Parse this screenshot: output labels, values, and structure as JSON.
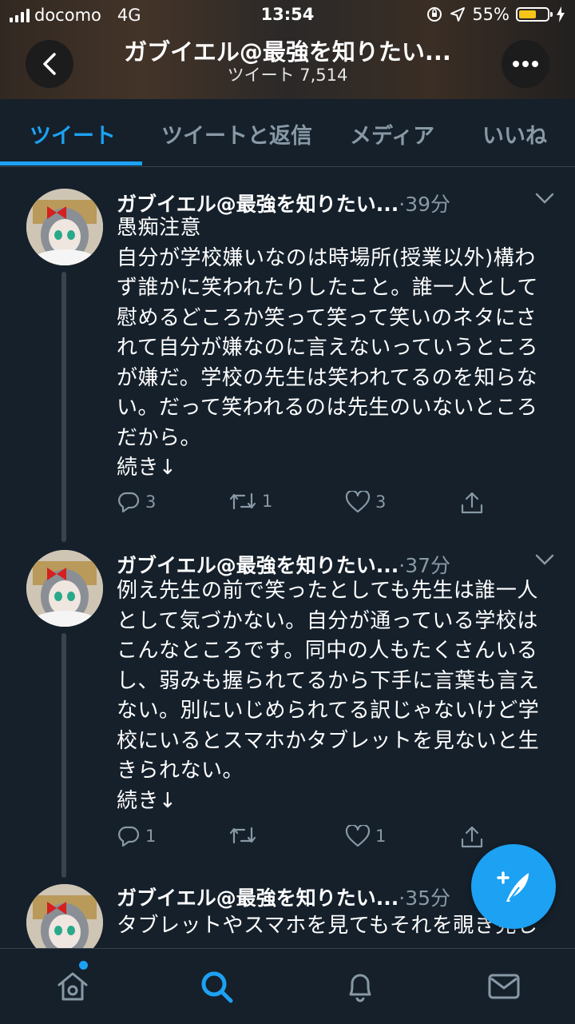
{
  "status_bar": {
    "carrier": "docomo",
    "network": "4G",
    "time": "13:54",
    "battery": "55%",
    "battery_level": 0.55
  },
  "header": {
    "title": "ガブイエル@最強を知りたい...",
    "tweet_count": "ツイート 7,514"
  },
  "tabs": [
    {
      "label": "ツイート",
      "active": true
    },
    {
      "label": "ツイートと返信",
      "active": false
    },
    {
      "label": "メディア",
      "active": false
    },
    {
      "label": "いいね",
      "active": false
    }
  ],
  "tweets": [
    {
      "name": "ガブイエル@最強を知りたい...",
      "time": "·39分",
      "text": "愚痴注意\n自分が学校嫌いなのは時場所(授業以外)構わず誰かに笑われたりしたこと。誰一人として慰めるどころか笑って笑って笑いのネタにされて自分が嫌なのに言えないっていうところが嫌だ。学校の先生は笑われてるのを知らない。だって笑われるのは先生のいないところだから。\n続き↓",
      "replies": "3",
      "retweets": "1",
      "likes": "3"
    },
    {
      "name": "ガブイエル@最強を知りたい...",
      "time": "·37分",
      "text": "例え先生の前で笑ったとしても先生は誰一人として気づかない。自分が通っている学校はこんなところです。同中の人もたくさんいるし、弱みも握られてるから下手に言葉も言えない。別にいじめられてる訳じゃないけど学校にいるとスマホかタブレットを見ないと生きられない。\n続き↓",
      "replies": "1",
      "retweets": "",
      "likes": "1"
    },
    {
      "name": "ガブイエル@最強を知りたい...",
      "time": "·35分",
      "text": "タブレットやスマホを見てもそれを覗き見し"
    }
  ],
  "icons": {
    "back": "chevron-left-icon",
    "more": "more-dots-icon",
    "caret": "chevron-down-icon",
    "reply": "reply-icon",
    "retweet": "retweet-icon",
    "like": "heart-icon",
    "share": "share-icon",
    "compose": "compose-feather-icon",
    "nav": [
      "home-icon",
      "search-icon",
      "notifications-icon",
      "messages-icon"
    ]
  },
  "colors": {
    "background": "#15202b",
    "accent": "#1da1f2",
    "secondary_text": "#8899a6",
    "battery": "#f5c518"
  }
}
